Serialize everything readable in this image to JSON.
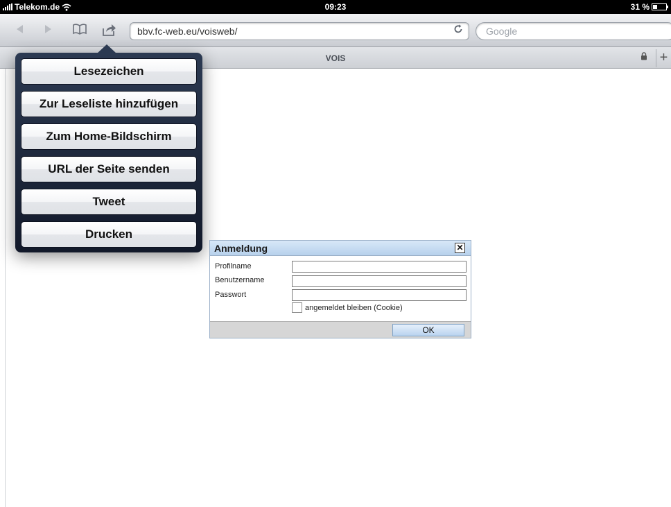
{
  "status_bar": {
    "carrier": "Telekom.de",
    "time": "09:23",
    "battery": "31 %",
    "battery_level": 0.31
  },
  "toolbar": {
    "back_icon": "back-arrow-icon",
    "forward_icon": "forward-arrow-icon",
    "bookmarks_icon": "book-icon",
    "share_icon": "share-icon",
    "url": "bbv.fc-web.eu/voisweb/",
    "reload_icon": "reload-icon",
    "search_placeholder": "Google"
  },
  "tab_bar": {
    "title": "VOIS",
    "lock_icon": "lock-icon",
    "new_tab_icon": "plus-icon"
  },
  "share_menu": {
    "items": [
      {
        "label": "Lesezeichen"
      },
      {
        "label": "Zur Leseliste hinzufügen"
      },
      {
        "label": "Zum Home-Bildschirm"
      },
      {
        "label": "URL der Seite senden"
      },
      {
        "label": "Tweet"
      },
      {
        "label": "Drucken"
      }
    ]
  },
  "login_dialog": {
    "title": "Anmeldung",
    "close": "✕",
    "fields": [
      {
        "label": "Profilname",
        "value": ""
      },
      {
        "label": "Benutzername",
        "value": ""
      },
      {
        "label": "Passwort",
        "value": ""
      }
    ],
    "remember_label": "angemeldet bleiben (Cookie)",
    "remember_checked": false,
    "ok_label": "OK"
  },
  "colors": {
    "popover_bg": "#1c2538",
    "dialog_header": "#c4daf1",
    "dialog_footer": "#d6d6d6"
  }
}
